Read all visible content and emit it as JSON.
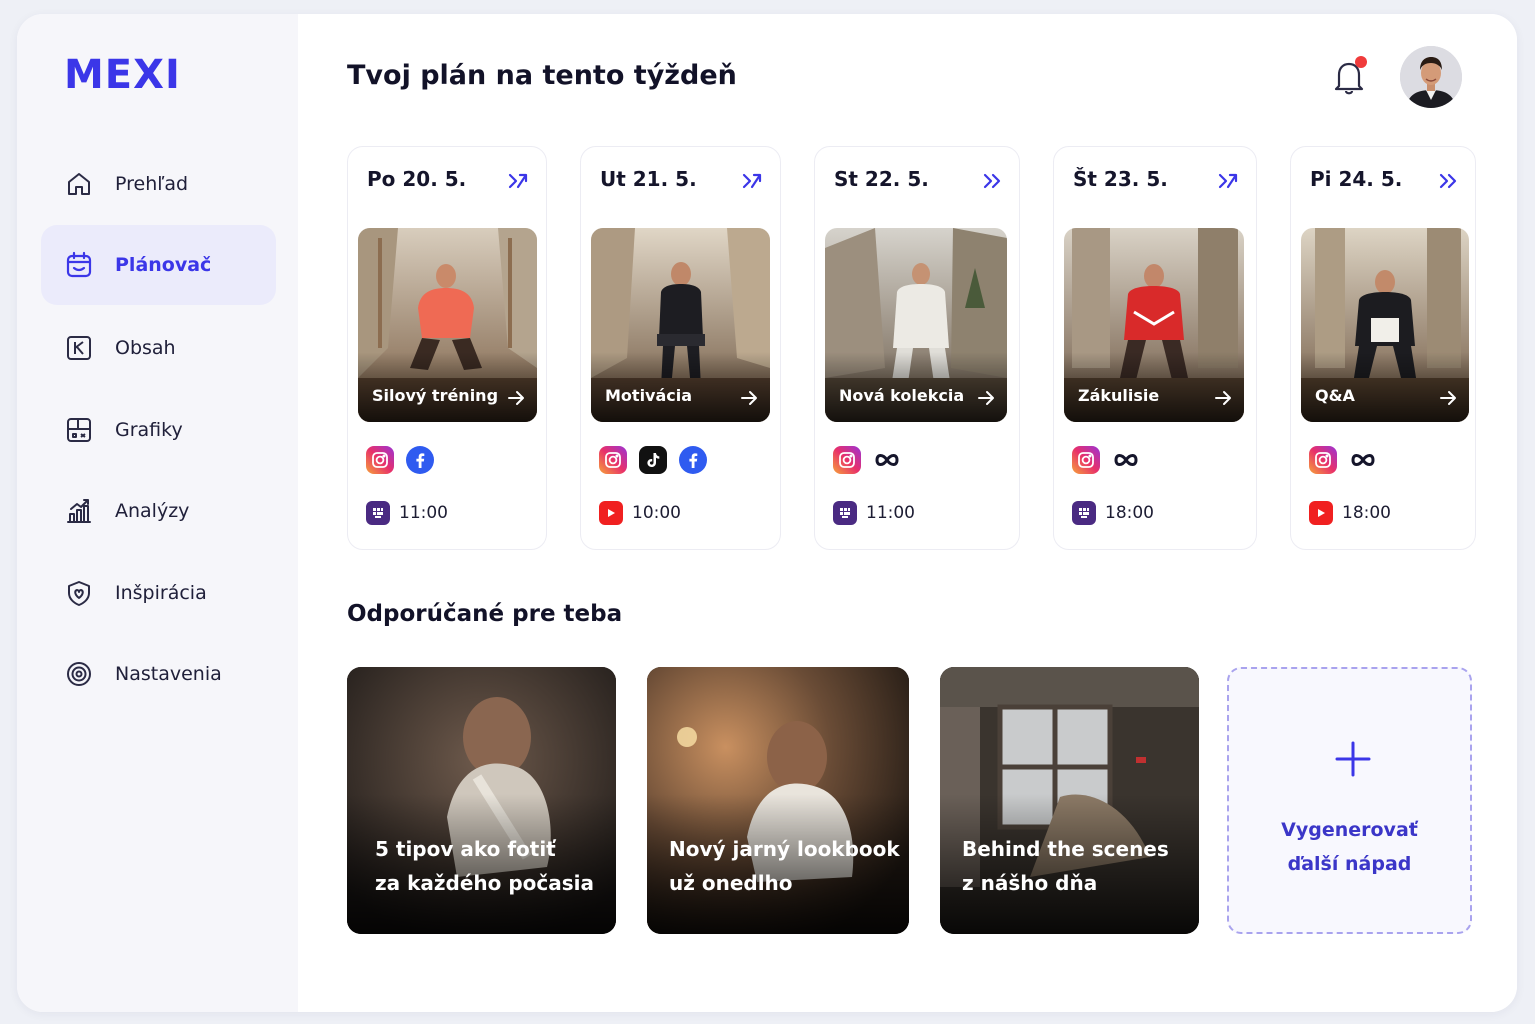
{
  "app": {
    "logo": "MEXI"
  },
  "sidebar": {
    "items": [
      {
        "label": "Prehľad",
        "icon": "home-icon"
      },
      {
        "label": "Plánovač",
        "icon": "calendar-icon",
        "active": true
      },
      {
        "label": "Obsah",
        "icon": "content-icon"
      },
      {
        "label": "Grafiky",
        "icon": "graphics-icon"
      },
      {
        "label": "Analýzy",
        "icon": "analytics-icon"
      },
      {
        "label": "Inšpirácia",
        "icon": "inspiration-icon"
      },
      {
        "label": "Nastavenia",
        "icon": "settings-icon"
      }
    ]
  },
  "header": {
    "title": "Tvoj plán na tento týždeň",
    "notification_dot": "#f03b3b"
  },
  "days": [
    {
      "date": "Po 20. 5.",
      "post": "Silový tréning",
      "socials": [
        "instagram",
        "facebook"
      ],
      "schedule_icon": "scheduler-app-icon",
      "time": "11:00"
    },
    {
      "date": "Ut 21. 5.",
      "post": "Motivácia",
      "socials": [
        "instagram",
        "tiktok",
        "facebook"
      ],
      "schedule_icon": "youtube-icon",
      "time": "10:00"
    },
    {
      "date": "St 22. 5.",
      "post": "Nová kolekcia",
      "socials": [
        "instagram",
        "meta"
      ],
      "schedule_icon": "scheduler-app-icon",
      "time": "11:00"
    },
    {
      "date": "Št 23. 5.",
      "post": "Zákulisie",
      "socials": [
        "instagram",
        "meta"
      ],
      "schedule_icon": "scheduler-app-icon",
      "time": "18:00"
    },
    {
      "date": "Pi 24. 5.",
      "post": "Q&A",
      "socials": [
        "instagram",
        "meta"
      ],
      "schedule_icon": "youtube-icon",
      "time": "18:00"
    }
  ],
  "recommended": {
    "title": "Odporúčané pre teba",
    "cards": [
      {
        "line1": "5 tipov ako fotiť",
        "line2": "za každého počasia"
      },
      {
        "line1": "Nový jarný lookbook",
        "line2": "už onedlho"
      },
      {
        "line1": "Behind the scenes",
        "line2": "z nášho dňa"
      }
    ],
    "generate": {
      "line1": "Vygenerovať",
      "line2": "ďalší nápad"
    }
  },
  "colors": {
    "accent": "#3b36e8",
    "sidebar_bg": "#f6f6fa",
    "active_bg": "#ebebfb",
    "youtube": "#f02020",
    "scheduler": "#4a2a82",
    "facebook": "#2f5bf0"
  }
}
